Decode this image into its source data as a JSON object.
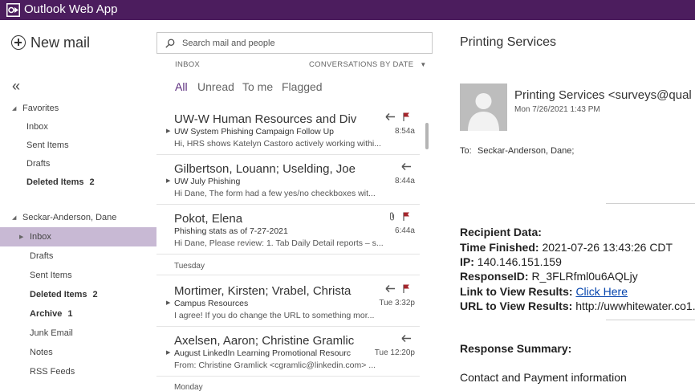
{
  "app": {
    "title": "Outlook Web App"
  },
  "nav": {
    "new_mail_label": "New mail",
    "favorites_label": "Favorites",
    "favorites": [
      {
        "label": "Inbox",
        "count": ""
      },
      {
        "label": "Sent Items",
        "count": ""
      },
      {
        "label": "Drafts",
        "count": ""
      },
      {
        "label": "Deleted Items",
        "count": "2"
      }
    ],
    "account_label": "Seckar-Anderson, Dane",
    "folders": [
      {
        "label": "Inbox",
        "count": ""
      },
      {
        "label": "Drafts",
        "count": ""
      },
      {
        "label": "Sent Items",
        "count": ""
      },
      {
        "label": "Deleted Items",
        "count": "2"
      },
      {
        "label": "Archive",
        "count": "1"
      },
      {
        "label": "Junk Email",
        "count": ""
      },
      {
        "label": "Notes",
        "count": ""
      },
      {
        "label": "RSS Feeds",
        "count": ""
      }
    ]
  },
  "search": {
    "placeholder": "Search mail and people"
  },
  "list_header": {
    "folder": "INBOX",
    "sort": "CONVERSATIONS BY DATE",
    "filters": [
      "All",
      "Unread",
      "To me",
      "Flagged"
    ]
  },
  "messages": [
    {
      "from": "UW-W Human Resources and Div",
      "subject": "UW System Phishing Campaign Follow Up",
      "preview": "Hi, HRS shows Katelyn Castoro actively working withi...",
      "time": "8:54a",
      "reply": true,
      "flag": true,
      "attachment": false
    },
    {
      "from": "Gilbertson, Louann; Uselding, Joe",
      "subject": "UW July Phishing",
      "preview": "Hi Dane, The form had a few yes/no checkboxes wit...",
      "time": "8:44a",
      "reply": true,
      "flag": false,
      "attachment": false
    },
    {
      "from": "Pokot, Elena",
      "subject": "Phishing stats as of 7-27-2021",
      "preview": "Hi Dane, Please review: 1. Tab Daily Detail reports – s...",
      "time": "6:44a",
      "reply": false,
      "flag": true,
      "attachment": true
    },
    {
      "from": "Mortimer, Kirsten; Vrabel, Christa",
      "subject": "Campus Resources",
      "preview": "I agree! If you do change the URL to something mor...",
      "time": "Tue 3:32p",
      "reply": true,
      "flag": true,
      "attachment": false
    },
    {
      "from": "Axelsen, Aaron; Christine Gramlic",
      "subject": "August LinkedIn Learning Promotional Resourc",
      "preview": "From: Christine Gramlick <cgramlic@linkedin.com> ...",
      "time": "Tue 12:20p",
      "reply": true,
      "flag": false,
      "attachment": false
    }
  ],
  "date_separators": [
    "Tuesday",
    "Monday"
  ],
  "reading_pane": {
    "subject": "Printing Services",
    "from": "Printing Services <surveys@qual",
    "date": "Mon 7/26/2021 1:43 PM",
    "to_label": "To:",
    "to": "Seckar-Anderson, Dane;",
    "body": {
      "recipient_data_label": "Recipient Data:",
      "time_finished_label": "Time Finished:",
      "time_finished": "2021-07-26 13:43:26 CDT",
      "ip_label": "IP:",
      "ip": "140.146.151.159",
      "response_id_label": "ResponseID:",
      "response_id": "R_3FLRfml0u6AQLjy",
      "link_label": "Link to View Results:",
      "link_text": "Click Here",
      "url_label": "URL to View Results:",
      "url": "http://uwwhitewater.co1.",
      "summary_label": "Response Summary:",
      "contact_line": "Contact and Payment information"
    }
  },
  "colors": {
    "topbar": "#4c1d5e",
    "accent": "#5c2d7e",
    "selected": "#c8b9d4",
    "flag": "#a4262c",
    "link": "#0645ad"
  }
}
